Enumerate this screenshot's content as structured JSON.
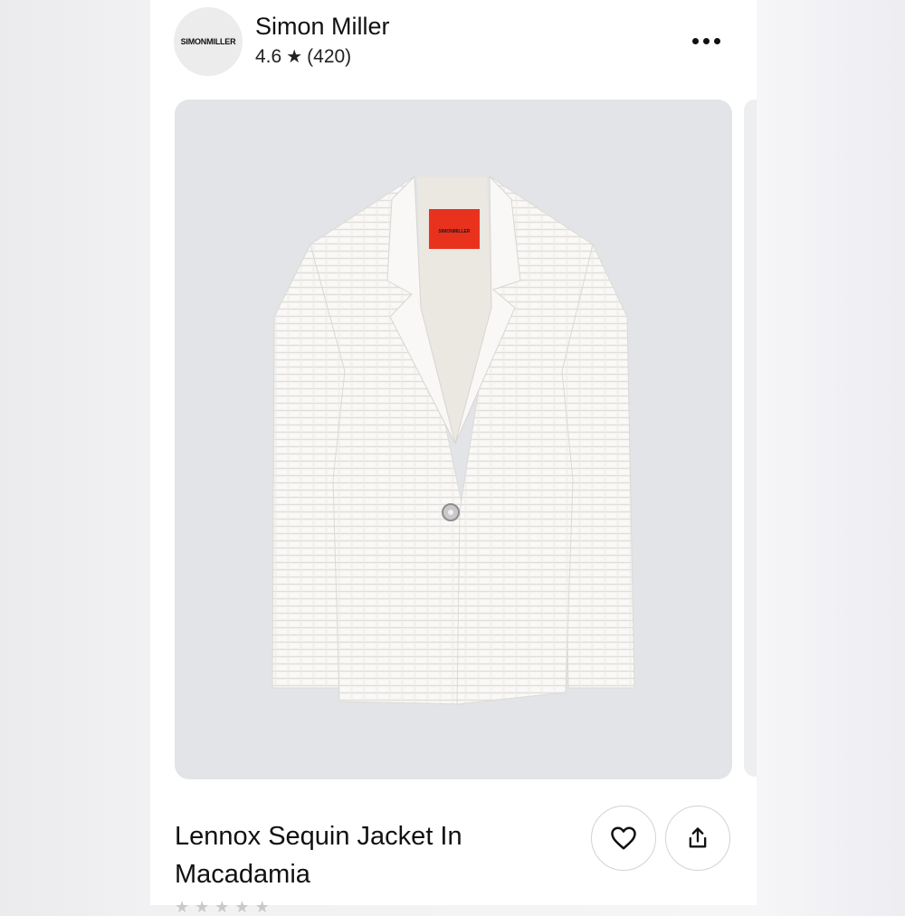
{
  "shop": {
    "name": "Simon Miller",
    "rating": "4.6",
    "star_glyph": "★",
    "review_count": "(420)",
    "avatar_text": "SIMONMILLER"
  },
  "header": {
    "more_icon": "more-horizontal-icon"
  },
  "product": {
    "title": "Lennox Sequin Jacket In Macadamia",
    "image_label_text": "SIMONMILLER",
    "image_label_color": "#e8321e"
  },
  "actions": {
    "favorite_icon": "heart-icon",
    "share_icon": "share-icon"
  }
}
